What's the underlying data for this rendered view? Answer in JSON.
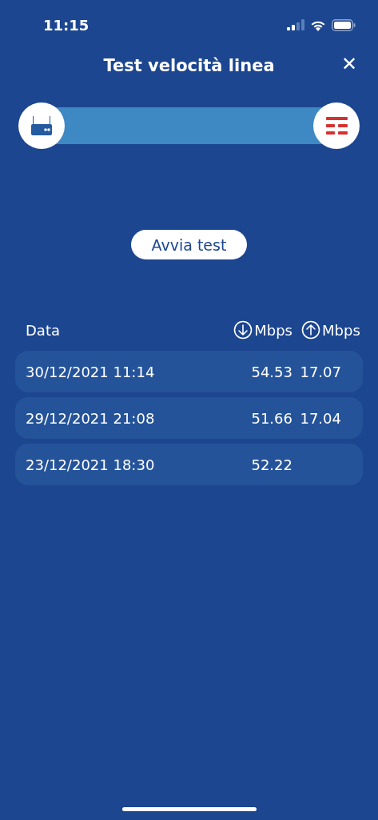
{
  "status_bar": {
    "time": "11:15"
  },
  "header": {
    "title": "Test velocità linea",
    "close": "✕"
  },
  "start_button": {
    "label": "Avvia test"
  },
  "table": {
    "columns": [
      {
        "kind": "date",
        "label": "Data"
      },
      {
        "kind": "download",
        "label": "Mbps"
      },
      {
        "kind": "upload",
        "label": "Mbps"
      }
    ],
    "rows": [
      {
        "date": "30/12/2021 11:14",
        "download": "54.53",
        "upload": "17.07"
      },
      {
        "date": "29/12/2021 21:08",
        "download": "51.66",
        "upload": "17.04"
      },
      {
        "date": "23/12/2021 18:30",
        "download": "52.22"
      }
    ]
  }
}
